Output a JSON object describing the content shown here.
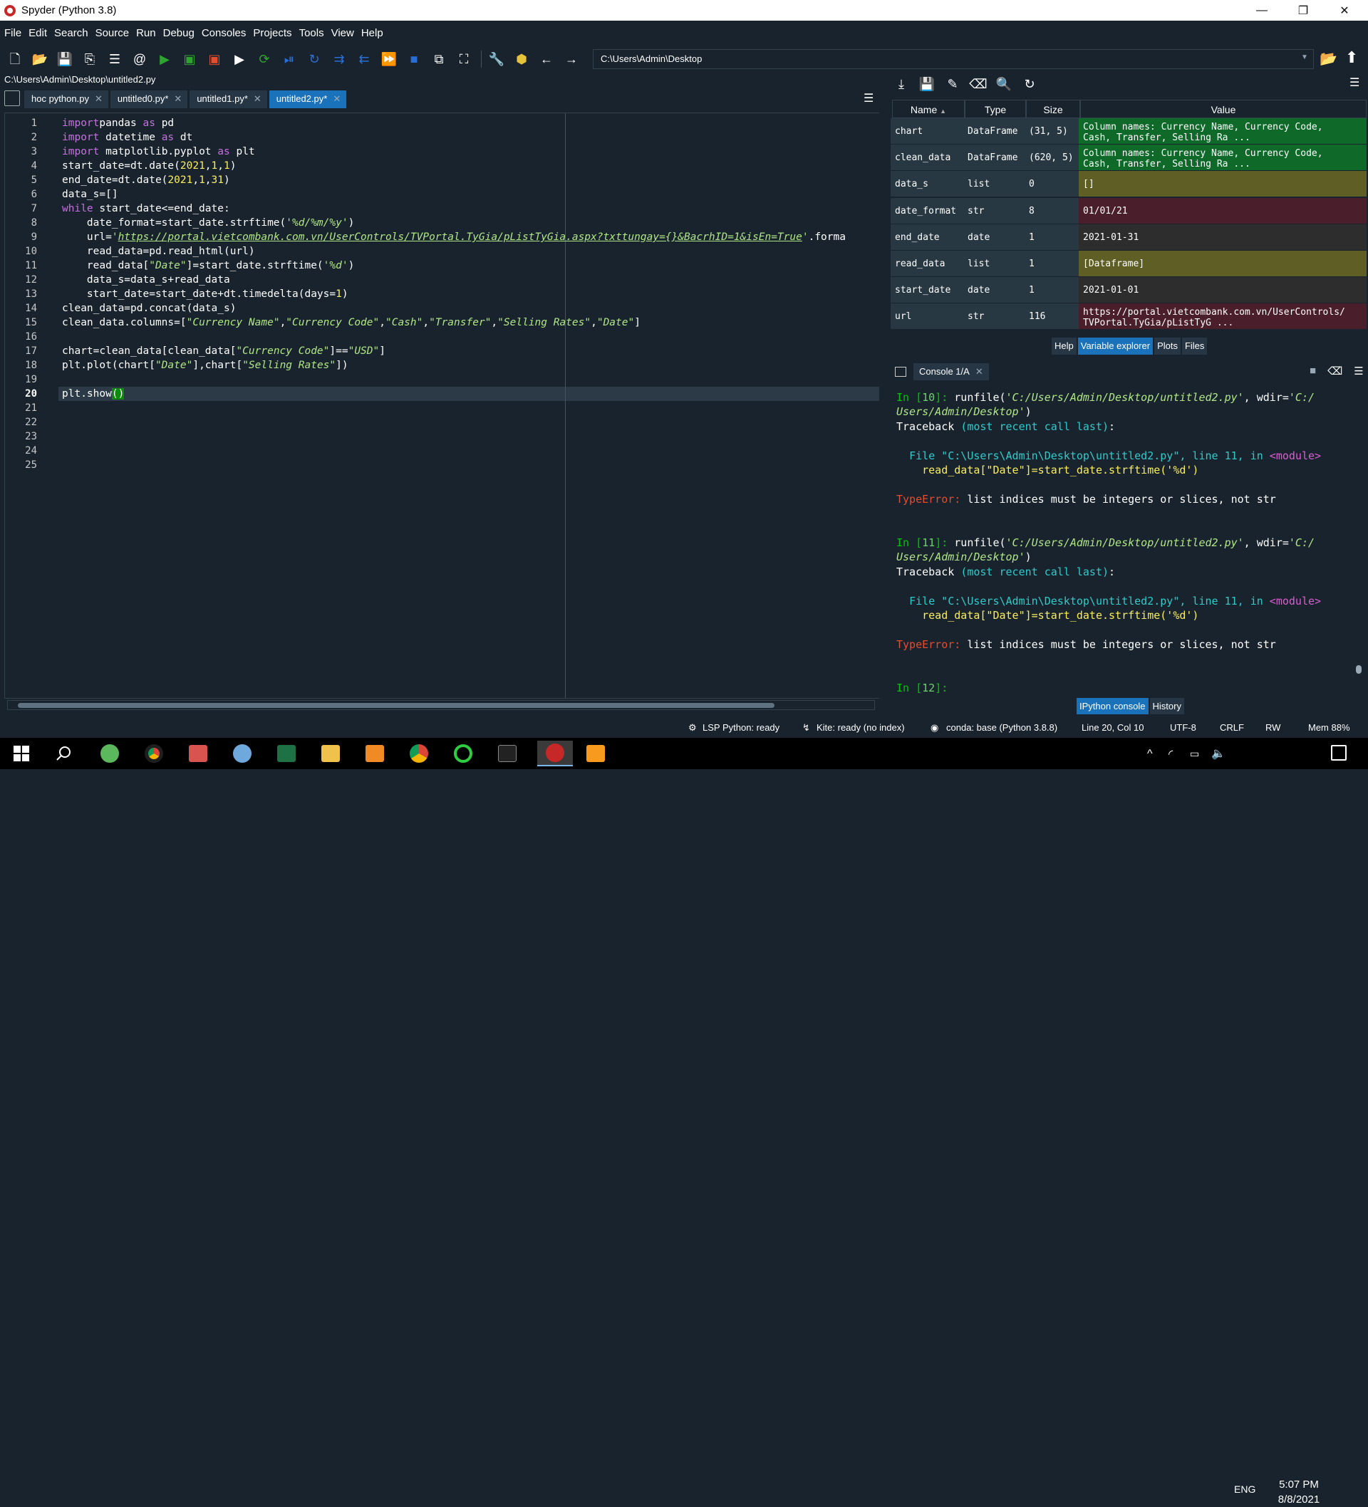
{
  "window": {
    "title": "Spyder (Python 3.8)",
    "minimize": "—",
    "restore": "❐",
    "close": "✕"
  },
  "menu": [
    "File",
    "Edit",
    "Search",
    "Source",
    "Run",
    "Debug",
    "Consoles",
    "Projects",
    "Tools",
    "View",
    "Help"
  ],
  "toolbar": {
    "path": "C:\\Users\\Admin\\Desktop",
    "icons": [
      "new-file-icon",
      "open-file-icon",
      "save-icon",
      "save-all-icon",
      "outline-icon",
      "email-icon",
      "run-icon",
      "run-cell-icon",
      "run-cell-advance-icon",
      "run-selection-icon",
      "rerun-icon",
      "debug-icon",
      "step-icon",
      "step-into-icon",
      "step-return-icon",
      "continue-icon",
      "stop-icon",
      "maximize-pane-icon",
      "fullscreen-icon",
      "preferences-icon",
      "python-path-icon",
      "back-icon",
      "forward-icon"
    ]
  },
  "editor": {
    "filepath": "C:\\Users\\Admin\\Desktop\\untitled2.py",
    "tabs": [
      {
        "label": "hoc python.py"
      },
      {
        "label": "untitled0.py*"
      },
      {
        "label": "untitled1.py*"
      },
      {
        "label": "untitled2.py*",
        "active": true
      }
    ],
    "line_numbers": [
      "1",
      "2",
      "3",
      "4",
      "5",
      "6",
      "7",
      "8",
      "9",
      "10",
      "11",
      "12",
      "13",
      "14",
      "15",
      "16",
      "17",
      "18",
      "19",
      "20",
      "21",
      "22",
      "23",
      "24",
      "25"
    ],
    "current_line": "20",
    "code": [
      [
        [
          "kw",
          "import"
        ],
        [
          "",
          "pandas "
        ],
        [
          "kw",
          "as"
        ],
        [
          "",
          " pd"
        ]
      ],
      [
        [
          "kw",
          "import"
        ],
        [
          "",
          " datetime "
        ],
        [
          "kw",
          "as"
        ],
        [
          "",
          " dt"
        ]
      ],
      [
        [
          "kw",
          "import"
        ],
        [
          "",
          " matplotlib.pyplot "
        ],
        [
          "kw",
          "as"
        ],
        [
          "",
          " plt"
        ]
      ],
      [
        [
          "",
          "start_date=dt.date("
        ],
        [
          "nm",
          "2021"
        ],
        [
          "",
          ","
        ],
        [
          "nm",
          "1"
        ],
        [
          "",
          ","
        ],
        [
          "nm",
          "1"
        ],
        [
          "",
          ")"
        ]
      ],
      [
        [
          "",
          "end_date=dt.date("
        ],
        [
          "nm",
          "2021"
        ],
        [
          "",
          ","
        ],
        [
          "nm",
          "1"
        ],
        [
          "",
          ","
        ],
        [
          "nm",
          "31"
        ],
        [
          "",
          ")"
        ]
      ],
      [
        [
          "",
          "data_s=[]"
        ]
      ],
      [
        [
          "kw",
          "while"
        ],
        [
          "",
          " start_date<=end_date:"
        ]
      ],
      [
        [
          "",
          "    date_format=start_date.strftime("
        ],
        [
          "st",
          "'%d/%m/%y'"
        ],
        [
          "",
          ")"
        ]
      ],
      [
        [
          "",
          "    url="
        ],
        [
          "st",
          "'"
        ],
        [
          "st ul",
          "https://portal.vietcombank.com.vn/UserControls/TVPortal.TyGia/pListTyGia.aspx?txttungay={}&BacrhID=1&isEn=True"
        ],
        [
          "st",
          "'"
        ],
        [
          "",
          ".forma"
        ]
      ],
      [
        [
          "",
          "    read_data=pd.read_html(url)"
        ]
      ],
      [
        [
          "",
          "    read_data["
        ],
        [
          "st",
          "\"Date\""
        ],
        [
          "",
          "]=start_date.strftime("
        ],
        [
          "st",
          "'%d'"
        ],
        [
          "",
          ")"
        ]
      ],
      [
        [
          "",
          "    data_s=data_s+read_data"
        ]
      ],
      [
        [
          "",
          "    start_date=start_date+dt.timedelta(days="
        ],
        [
          "nm",
          "1"
        ],
        [
          "",
          ")"
        ]
      ],
      [
        [
          "",
          "clean_data=pd.concat(data_s)"
        ]
      ],
      [
        [
          "",
          "clean_data.columns=["
        ],
        [
          "st",
          "\"Currency Name\""
        ],
        [
          "",
          ","
        ],
        [
          "st",
          "\"Currency Code\""
        ],
        [
          "",
          ","
        ],
        [
          "st",
          "\"Cash\""
        ],
        [
          "",
          ","
        ],
        [
          "st",
          "\"Transfer\""
        ],
        [
          "",
          ","
        ],
        [
          "st",
          "\"Selling Rates\""
        ],
        [
          "",
          ","
        ],
        [
          "st",
          "\"Date\""
        ],
        [
          "",
          "]"
        ]
      ],
      [],
      [
        [
          "",
          "chart=clean_data[clean_data["
        ],
        [
          "st",
          "\"Currency Code\""
        ],
        [
          "",
          "]=="
        ],
        [
          "st",
          "\"USD\""
        ],
        [
          "",
          "]"
        ]
      ],
      [
        [
          "",
          "plt.plot(chart["
        ],
        [
          "st",
          "\"Date\""
        ],
        [
          "",
          "],chart["
        ],
        [
          "st",
          "\"Selling Rates\""
        ],
        [
          "",
          "])"
        ]
      ],
      [],
      [
        [
          "",
          "plt.show"
        ],
        [
          "br",
          "()"
        ]
      ],
      [],
      [],
      [],
      [],
      []
    ]
  },
  "variable_explorer": {
    "headers": {
      "name": "Name",
      "type": "Type",
      "size": "Size",
      "value": "Value"
    },
    "rows": [
      {
        "name": "chart",
        "type": "DataFrame",
        "size": "(31, 5)",
        "value": "Column names: Currency Name, Currency Code,\nCash, Transfer, Selling Ra ...",
        "color": "#0f6a2a"
      },
      {
        "name": "clean_data",
        "type": "DataFrame",
        "size": "(620, 5)",
        "value": "Column names: Currency Name, Currency Code,\nCash, Transfer, Selling Ra ...",
        "color": "#0f6a2a"
      },
      {
        "name": "data_s",
        "type": "list",
        "size": "0",
        "value": "[]",
        "color": "#5f5e24"
      },
      {
        "name": "date_format",
        "type": "str",
        "size": "8",
        "value": "01/01/21",
        "color": "#4a1f2b"
      },
      {
        "name": "end_date",
        "type": "date",
        "size": "1",
        "value": "2021-01-31",
        "color": "#2d2d2d"
      },
      {
        "name": "read_data",
        "type": "list",
        "size": "1",
        "value": "[Dataframe]",
        "color": "#5f5e24"
      },
      {
        "name": "start_date",
        "type": "date",
        "size": "1",
        "value": "2021-01-01",
        "color": "#2d2d2d"
      },
      {
        "name": "url",
        "type": "str",
        "size": "116",
        "value": "https://portal.vietcombank.com.vn/UserControls/\nTVPortal.TyGia/pListTyG ...",
        "color": "#4a1f2b"
      }
    ],
    "tabs": [
      {
        "label": "Help"
      },
      {
        "label": "Variable explorer",
        "active": true
      },
      {
        "label": "Plots"
      },
      {
        "label": "Files"
      }
    ]
  },
  "console": {
    "tab": "Console 1/A",
    "lines": [
      [
        [
          "cg",
          "In ["
        ],
        [
          "cgr",
          "10"
        ],
        [
          "cg",
          "]: "
        ],
        [
          "",
          "runfile("
        ],
        [
          "ci",
          "'C:/Users/Admin/Desktop/untitled2.py'"
        ],
        [
          "",
          ", wdir="
        ],
        [
          "ci",
          "'C:/"
        ]
      ],
      [
        [
          "ci",
          "Users/Admin/Desktop'"
        ],
        [
          "",
          ")"
        ]
      ],
      [
        [
          "",
          "Traceback "
        ],
        [
          "cc",
          "(most recent call last)"
        ],
        [
          "",
          ":"
        ]
      ],
      [],
      [
        [
          "",
          "  "
        ],
        [
          "cc",
          "File "
        ],
        [
          "cc",
          "\"C:\\Users\\Admin\\Desktop\\untitled2.py\""
        ],
        [
          "cc",
          ", line "
        ],
        [
          "cc",
          "11"
        ],
        [
          "cc",
          ", in "
        ],
        [
          "cpk",
          "<module>"
        ]
      ],
      [
        [
          "",
          "    "
        ],
        [
          "cy",
          "read_data[\"Date\"]=start_date.strftime('%d')"
        ]
      ],
      [],
      [
        [
          "cr",
          "TypeError:"
        ],
        [
          "",
          " list indices must be integers or slices, not str"
        ]
      ],
      [],
      [],
      [
        [
          "cg",
          "In ["
        ],
        [
          "cgr",
          "11"
        ],
        [
          "cg",
          "]: "
        ],
        [
          "",
          "runfile("
        ],
        [
          "ci",
          "'C:/Users/Admin/Desktop/untitled2.py'"
        ],
        [
          "",
          ", wdir="
        ],
        [
          "ci",
          "'C:/"
        ]
      ],
      [
        [
          "ci",
          "Users/Admin/Desktop'"
        ],
        [
          "",
          ")"
        ]
      ],
      [
        [
          "",
          "Traceback "
        ],
        [
          "cc",
          "(most recent call last)"
        ],
        [
          "",
          ":"
        ]
      ],
      [],
      [
        [
          "",
          "  "
        ],
        [
          "cc",
          "File "
        ],
        [
          "cc",
          "\"C:\\Users\\Admin\\Desktop\\untitled2.py\""
        ],
        [
          "cc",
          ", line "
        ],
        [
          "cc",
          "11"
        ],
        [
          "cc",
          ", in "
        ],
        [
          "cpk",
          "<module>"
        ]
      ],
      [
        [
          "",
          "    "
        ],
        [
          "cy",
          "read_data[\"Date\"]=start_date.strftime('%d')"
        ]
      ],
      [],
      [
        [
          "cr",
          "TypeError:"
        ],
        [
          "",
          " list indices must be integers or slices, not str"
        ]
      ],
      [],
      [],
      [
        [
          "cg",
          "In ["
        ],
        [
          "cgr",
          "12"
        ],
        [
          "cg",
          "]: "
        ]
      ]
    ],
    "tabs": [
      {
        "label": "IPython console",
        "active": true
      },
      {
        "label": "History"
      }
    ]
  },
  "status": {
    "lsp": "LSP Python: ready",
    "kite": "Kite: ready (no index)",
    "conda": "conda: base (Python 3.8.8)",
    "position": "Line 20, Col 10",
    "encoding": "UTF-8",
    "eol": "CRLF",
    "rw": "RW",
    "mem": "Mem 88%"
  },
  "taskbar": {
    "apps": [
      "start-icon",
      "search-icon",
      "greenshot-icon",
      "chrome-icon",
      "app-icon",
      "paint-icon",
      "excel-icon",
      "explorer-icon",
      "media-icon",
      "chrome-profile-icon",
      "refresh-app-icon",
      "terminal-icon",
      "spyder-icon",
      "sublime-icon"
    ],
    "lang": "ENG",
    "time": "5:07 PM",
    "date": "8/8/2021"
  }
}
